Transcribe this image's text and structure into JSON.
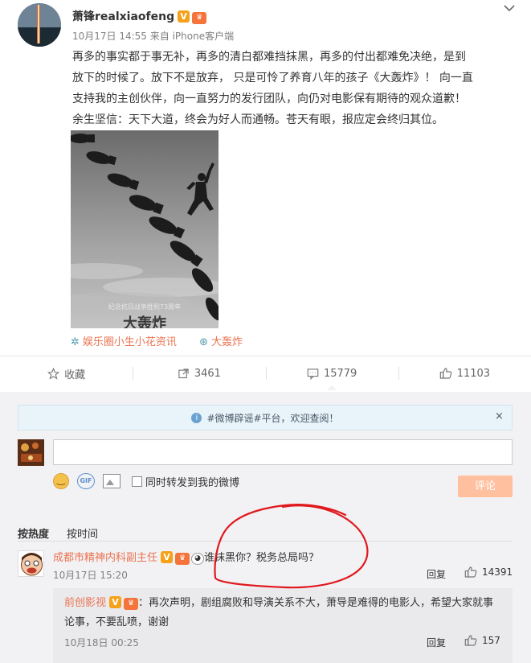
{
  "post": {
    "author": "萧锋realxiaofeng",
    "time": "10月17日 14:55",
    "source": "来自 iPhone客户端",
    "text_lines": [
      "再多的事实都于事无补，再多的清白都难挡抹黑，再多的付出都难免决绝，是到",
      "放下的时候了。放下不是放弃， 只是可怜了养育八年的孩子《大轰炸》！ 向一直",
      "支持我的主创伙伴，向一直努力的发行团队，向仍对电影保有期待的观众道歉！",
      "余生坚信：天下大道，终会为好人而通畅。苍天有眼，报应定会终归其位。"
    ],
    "poster": {
      "subtitle": "纪念抗日战争胜利73周年",
      "title": "大轰炸"
    },
    "tags": [
      {
        "icon": "flower-icon",
        "label": "娱乐圈小生小花资讯"
      },
      {
        "icon": "film-icon",
        "label": "大轰炸"
      }
    ]
  },
  "actions": [
    {
      "icon": "star-icon",
      "label": "收藏"
    },
    {
      "icon": "share-icon",
      "label": "3461"
    },
    {
      "icon": "comment-icon",
      "label": "15779"
    },
    {
      "icon": "thumb-up-icon",
      "label": "11103"
    }
  ],
  "notice": {
    "icon": "info-icon",
    "text": "#微博辟谣#平台，欢迎查阅！",
    "close": "×"
  },
  "composer": {
    "placeholder": "",
    "gif_label": "GIF",
    "repost_label": "同时转发到我的微博",
    "submit_label": "评论"
  },
  "sort": {
    "hot": "按热度",
    "time": "按时间"
  },
  "comment": {
    "author": "成都市精神内科副主任",
    "text": "谁抹黑你？税务总局吗？",
    "time": "10月17日 15:20",
    "reply": "回复",
    "likes": "14391"
  },
  "reply_item": {
    "author": "前创影视",
    "text_line1": "：再次声明，剧组腐败和导演关系不大，萧导是难得的电影人，希望大家就事",
    "text_line2": "论事，不要乱喷，谢谢",
    "time": "10月18日 00:25",
    "reply": "回复",
    "likes": "157"
  },
  "colors": {
    "accent": "#eb7350",
    "annotation": "#e0191e"
  }
}
